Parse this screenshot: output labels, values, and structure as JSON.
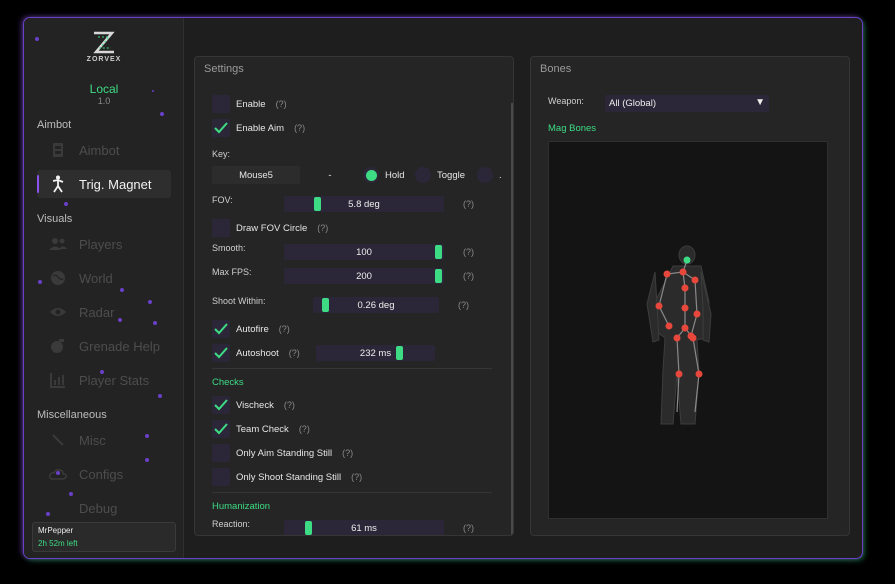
{
  "app": {
    "logo_text": "ZORVEX",
    "build_name": "Local",
    "build_version": "1.0"
  },
  "sidebar": {
    "sections": [
      {
        "label": "Aimbot"
      },
      {
        "label": "Visuals"
      },
      {
        "label": "Miscellaneous"
      }
    ],
    "items": [
      {
        "label": "Aimbot",
        "icon": "target-icon",
        "active": false
      },
      {
        "label": "Trig. Magnet",
        "icon": "person-icon",
        "active": true
      },
      {
        "label": "Players",
        "icon": "players-icon",
        "active": false
      },
      {
        "label": "World",
        "icon": "globe-icon",
        "active": false
      },
      {
        "label": "Radar",
        "icon": "eye-icon",
        "active": false
      },
      {
        "label": "Grenade Help",
        "icon": "grenade-icon",
        "active": false
      },
      {
        "label": "Player Stats",
        "icon": "stats-icon",
        "active": false
      },
      {
        "label": "Misc",
        "icon": "wand-icon",
        "active": false
      },
      {
        "label": "Configs",
        "icon": "cloud-icon",
        "active": false
      },
      {
        "label": "Debug",
        "icon": "bug-icon",
        "active": false
      }
    ],
    "user": {
      "name": "MrPepper",
      "time_left": "2h 52m left"
    }
  },
  "settings": {
    "title": "Settings",
    "help": "(?)",
    "enable": {
      "label": "Enable",
      "checked": false
    },
    "enable_aim": {
      "label": "Enable Aim",
      "checked": true
    },
    "key_label": "Key:",
    "key_value": "Mouse5",
    "key_separator": "-",
    "mode_hold": {
      "label": "Hold",
      "selected": true
    },
    "mode_toggle": {
      "label": "Toggle",
      "selected": false
    },
    "mode_third_label": ".",
    "fov": {
      "label": "FOV:",
      "value": "5.8 deg",
      "fraction": 0.18
    },
    "draw_fov": {
      "label": "Draw FOV Circle",
      "checked": false
    },
    "smooth": {
      "label": "Smooth:",
      "value": "100",
      "fraction": 1.0
    },
    "max_fps": {
      "label": "Max FPS:",
      "value": "200",
      "fraction": 1.0
    },
    "shoot_within": {
      "label": "Shoot Within:",
      "value": "0.26 deg",
      "fraction": 0.05
    },
    "autofire": {
      "label": "Autofire",
      "checked": true
    },
    "autoshoot": {
      "label": "Autoshoot",
      "checked": true,
      "value": "232 ms",
      "fraction": 0.72
    },
    "checks_title": "Checks",
    "vischeck": {
      "label": "Vischeck",
      "checked": true
    },
    "team_check": {
      "label": "Team Check",
      "checked": true
    },
    "aim_standing": {
      "label": "Only Aim Standing Still",
      "checked": false
    },
    "shoot_standing": {
      "label": "Only Shoot Standing Still",
      "checked": false
    },
    "humanization_title": "Humanization",
    "reaction": {
      "label": "Reaction:",
      "value": "61 ms",
      "fraction": 0.12
    }
  },
  "bones": {
    "title": "Bones",
    "weapon_label": "Weapon:",
    "weapon_value": "All (Global)",
    "mag_bones_label": "Mag Bones"
  },
  "colors": {
    "accent_green": "#3ddc84",
    "accent_purple": "#8a52f0",
    "bone_red": "#e8473c"
  }
}
